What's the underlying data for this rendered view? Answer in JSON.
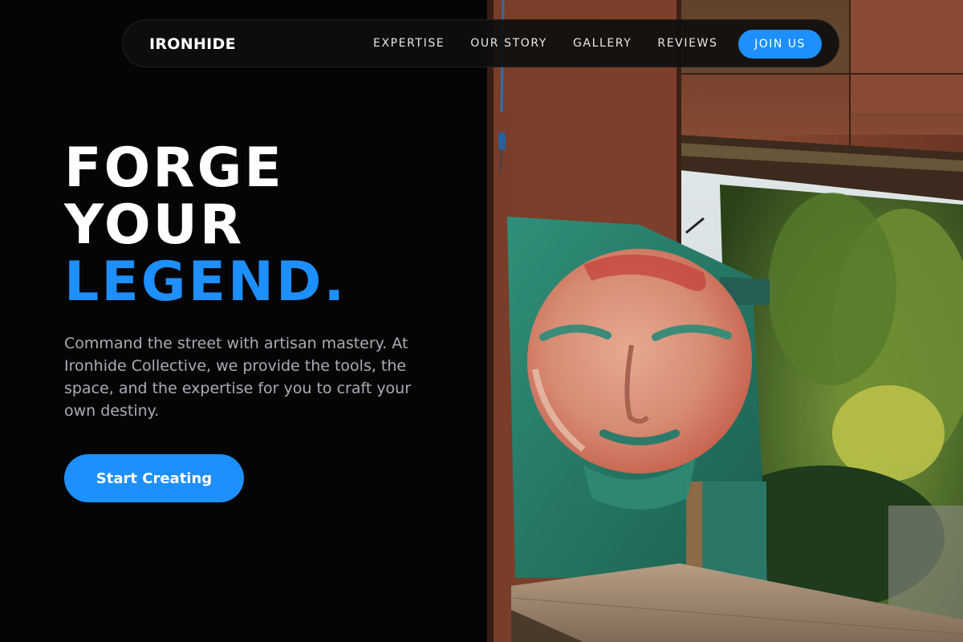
{
  "nav": {
    "brand": "IRONHIDE",
    "links": [
      {
        "label": "EXPERTISE"
      },
      {
        "label": "OUR STORY"
      },
      {
        "label": "GALLERY"
      },
      {
        "label": "REVIEWS"
      }
    ],
    "join_label": "JOIN US"
  },
  "hero": {
    "title_line1": "FORGE",
    "title_line2": "YOUR",
    "title_accent": "LEGEND.",
    "description": "Command the street with artisan mastery. At Ironhide Collective, we provide the tools, the space, and the expertise for you to craft your own destiny.",
    "cta_label": "Start Creating"
  },
  "image": {
    "subject": "painted-face-artwork-in-rusted-metal-doorway"
  },
  "colors": {
    "accent": "#1e8fff",
    "background": "#050505",
    "text": "#ffffff",
    "muted_text": "#a9adb6"
  }
}
